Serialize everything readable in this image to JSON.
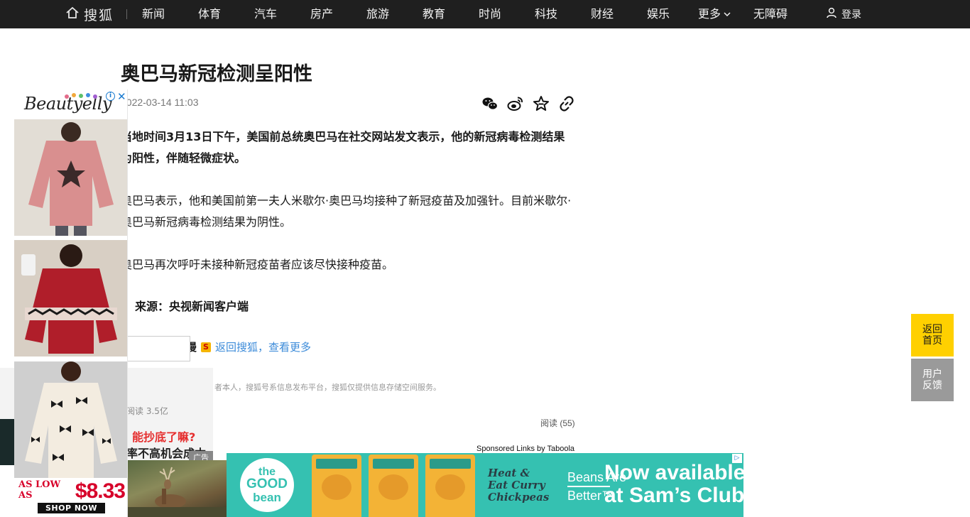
{
  "nav": {
    "brand": "搜狐",
    "items": [
      "新闻",
      "体育",
      "汽车",
      "房产",
      "旅游",
      "教育",
      "时尚",
      "科技",
      "财经",
      "娱乐"
    ],
    "more": "更多",
    "accessibility": "无障碍",
    "login": "登录"
  },
  "article": {
    "title": "奥巴马新冠检测呈阳性",
    "time": "2022-03-14 11:03",
    "share_icons": [
      "wechat-icon",
      "weibo-icon",
      "star-icon",
      "link-icon"
    ],
    "paragraphs": [
      "当地时间3月13日下午，美国前总统奥巴马在社交网站发文表示，他的新冠病毒检测结果为阳性，伴随轻微症状。",
      "奥巴马表示，他和美国前第一夫人米歇尔·奥巴马均接种了新冠疫苗及加强针。目前米歇尔·奥巴马新冠病毒检测结果为阴性。",
      "奥巴马再次呼吁未接种新冠疫苗者应该尽快接种疫苗。"
    ],
    "source": "来源：央视新闻客户端",
    "back_link": "返回搜狐，查看更多",
    "back_prefix": "漫",
    "disclaimer": "者本人，搜狐号系信息发布平台，搜狐仅提供信息存储空间服务。",
    "read_count": "阅读 (55)",
    "sponsored": "Sponsored Links by Taboola"
  },
  "underlying_ad": {
    "stats": "阅读  3.5亿",
    "headline_q": "能抄底了嘛?",
    "headline": "率不高机会成本却高",
    "tag": "广告"
  },
  "left_ad": {
    "brand": "Beautyelly",
    "as_low_as": "AS LOW AS",
    "price": "$8.33",
    "cta": "SHOP NOW"
  },
  "banner_ad": {
    "logo_lines": [
      "the",
      "GOOD",
      "bean"
    ],
    "heat_lines": [
      "Heat &",
      "Eat Curry",
      "Chickpeas"
    ],
    "better_lines": [
      "Beans Are",
      "Better™"
    ],
    "headline_lines": [
      "Now available",
      "at Sam’s Club!"
    ]
  },
  "float": {
    "home_lines": [
      "返回",
      "首页"
    ],
    "feedback_lines": [
      "用户",
      "反馈"
    ]
  },
  "colors": {
    "nav_bg": "#1f1f1f",
    "link": "#3c8bd9",
    "home_btn": "#ffd000",
    "feedback_btn": "#9a9a9a",
    "banner_bg": "#35c1b1",
    "price_red": "#d7002a"
  }
}
